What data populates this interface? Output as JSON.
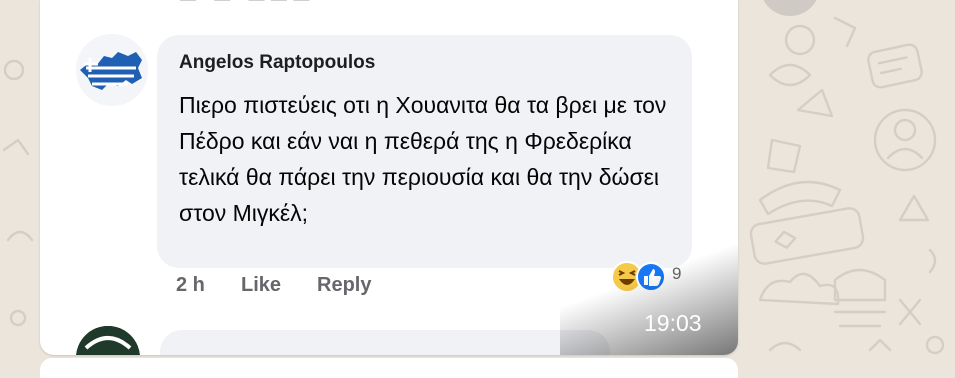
{
  "chat": {
    "wallpaper": "whatsapp-doodle",
    "message": {
      "time": "19:03",
      "image": {
        "comment": {
          "author": "Angelos Raptopoulos",
          "avatar": "greece-flag-map",
          "text": "Πιερο πιστεύεις οτι η Χουανιτα θα τα βρει με τον Πέδρο και εάν ναι η πεθερά της η Φρεδερίκα τελικά θα πάρει την περιουσία και θα την δώσει στον Μιγκέλ;",
          "age": "2 h",
          "like_label": "Like",
          "reply_label": "Reply",
          "reactions": {
            "icons": [
              "haha",
              "like"
            ],
            "count": "9"
          }
        }
      }
    }
  },
  "colors": {
    "wallpaper": "#ece5dc",
    "card": "#ffffff",
    "comment_bubble": "#f0f2f5",
    "muted_text": "#65676b",
    "like_blue": "#1877f2",
    "haha_yellow": "#f7c948"
  }
}
